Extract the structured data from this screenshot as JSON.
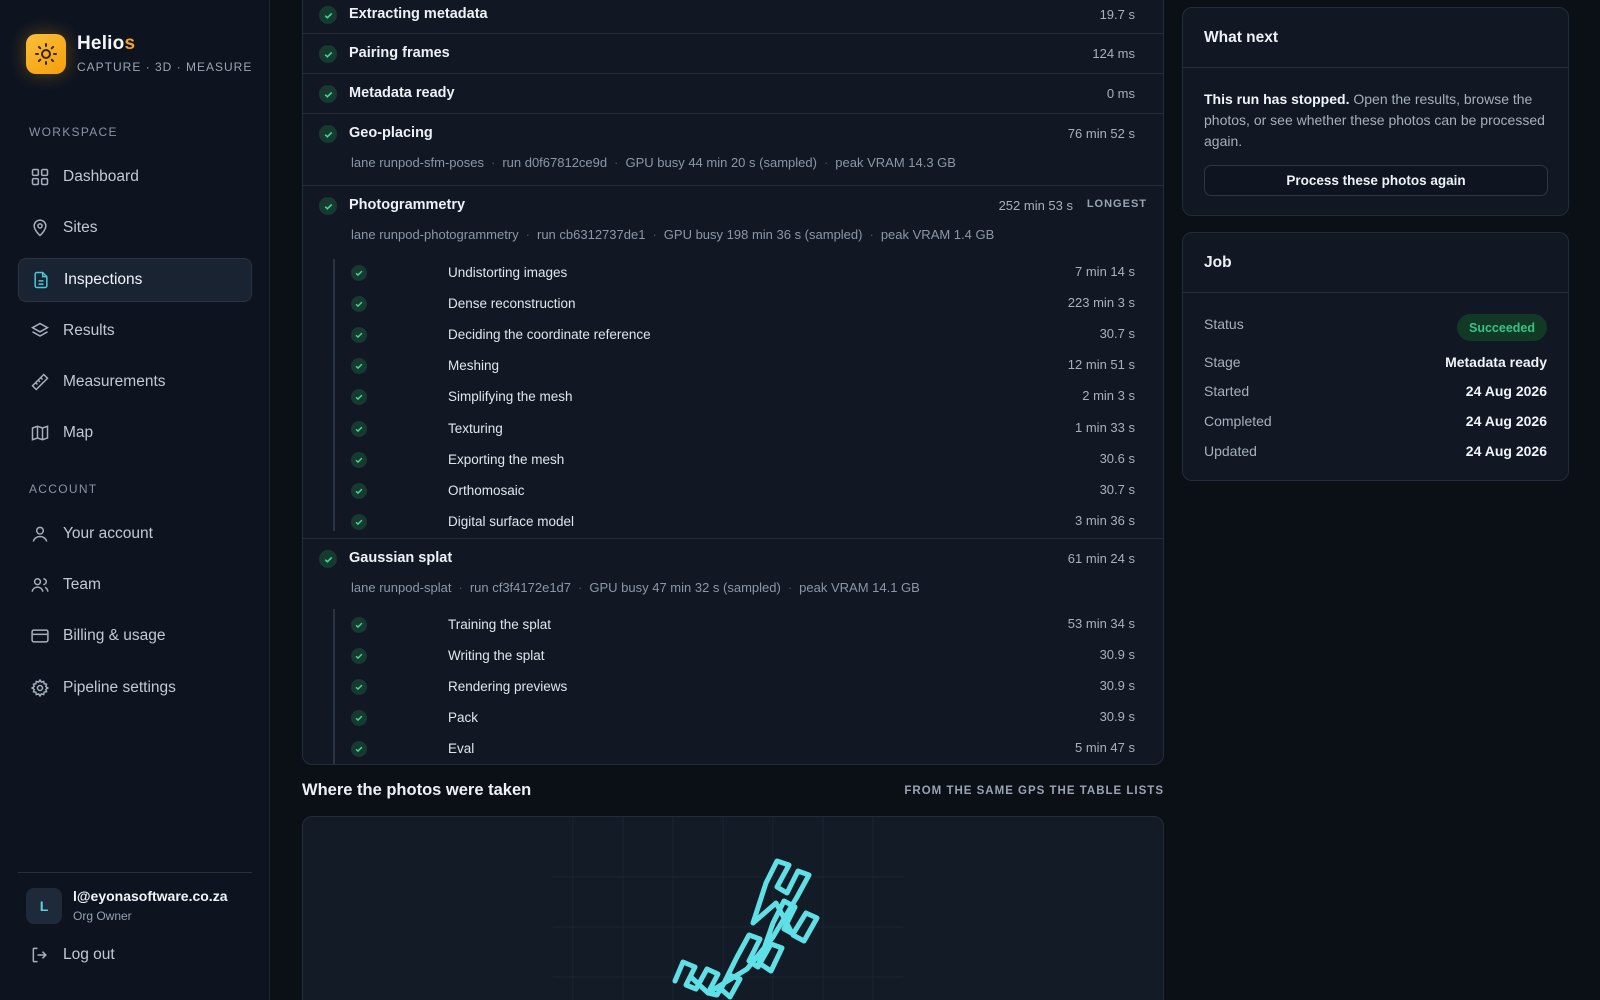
{
  "brand": {
    "name_main": "Helio",
    "name_accent": "s",
    "tagline": "CAPTURE · 3D · MEASURE",
    "accent_color": "#f5a524"
  },
  "sidebar": {
    "workspace_label": "WORKSPACE",
    "workspace_items": [
      {
        "label": "Dashboard",
        "icon": "grid-icon"
      },
      {
        "label": "Sites",
        "icon": "map-pin-icon"
      },
      {
        "label": "Inspections",
        "icon": "document-icon",
        "active": true
      },
      {
        "label": "Results",
        "icon": "layers-icon"
      },
      {
        "label": "Measurements",
        "icon": "ruler-icon"
      },
      {
        "label": "Map",
        "icon": "map-icon"
      }
    ],
    "account_label": "ACCOUNT",
    "account_items": [
      {
        "label": "Your account",
        "icon": "user-icon"
      },
      {
        "label": "Team",
        "icon": "users-icon"
      },
      {
        "label": "Billing & usage",
        "icon": "credit-card-icon"
      },
      {
        "label": "Pipeline settings",
        "icon": "gear-icon"
      }
    ],
    "user": {
      "initial": "L",
      "email": "l@eyonasoftware.co.za",
      "role": "Org Owner"
    },
    "logout_label": "Log out"
  },
  "stages": [
    {
      "name": "Extracting metadata",
      "time": "19.7 s"
    },
    {
      "name": "Pairing frames",
      "time": "124 ms"
    },
    {
      "name": "Metadata ready",
      "time": "0 ms"
    },
    {
      "name": "Geo-placing",
      "time": "76 min 52 s",
      "meta": [
        "lane runpod-sfm-poses",
        "run d0f67812ce9d",
        "GPU busy 44 min 20 s (sampled)",
        "peak VRAM 14.3 GB"
      ]
    },
    {
      "name": "Photogrammetry",
      "time": "252 min 53 s",
      "tag": "LONGEST",
      "meta": [
        "lane runpod-photogrammetry",
        "run cb6312737de1",
        "GPU busy 198 min 36 s (sampled)",
        "peak VRAM 1.4 GB"
      ],
      "substeps": [
        {
          "name": "Undistorting images",
          "time": "7 min 14 s"
        },
        {
          "name": "Dense reconstruction",
          "time": "223 min 3 s"
        },
        {
          "name": "Deciding the coordinate reference",
          "time": "30.7 s"
        },
        {
          "name": "Meshing",
          "time": "12 min 51 s"
        },
        {
          "name": "Simplifying the mesh",
          "time": "2 min 3 s"
        },
        {
          "name": "Texturing",
          "time": "1 min 33 s"
        },
        {
          "name": "Exporting the mesh",
          "time": "30.6 s"
        },
        {
          "name": "Orthomosaic",
          "time": "30.7 s"
        },
        {
          "name": "Digital surface model",
          "time": "3 min 36 s"
        }
      ]
    },
    {
      "name": "Gaussian splat",
      "time": "61 min 24 s",
      "meta": [
        "lane runpod-splat",
        "run cf3f4172e1d7",
        "GPU busy 47 min 32 s (sampled)",
        "peak VRAM 14.1 GB"
      ],
      "substeps": [
        {
          "name": "Training the splat",
          "time": "53 min 34 s"
        },
        {
          "name": "Writing the splat",
          "time": "30.9 s"
        },
        {
          "name": "Rendering previews",
          "time": "30.9 s"
        },
        {
          "name": "Pack",
          "time": "30.9 s"
        },
        {
          "name": "Eval",
          "time": "5 min 47 s"
        }
      ]
    }
  ],
  "map_section": {
    "title": "Where the photos were taken",
    "note": "FROM THE SAME GPS THE TABLE LISTS",
    "path_color": "#5fe0e6"
  },
  "what_next": {
    "title": "What next",
    "lead": "This run has stopped.",
    "body": "Open the results, browse the photos, or see whether these photos can be processed again.",
    "button_label": "Process these photos again"
  },
  "job": {
    "title": "Job",
    "status_label": "Status",
    "status_value": "Succeeded",
    "status_color": "#35c486",
    "stage_label": "Stage",
    "stage_value": "Metadata ready",
    "started_label": "Started",
    "started_value": "24 Aug 2026",
    "completed_label": "Completed",
    "completed_value": "24 Aug 2026",
    "updated_label": "Updated",
    "updated_value": "24 Aug 2026"
  }
}
